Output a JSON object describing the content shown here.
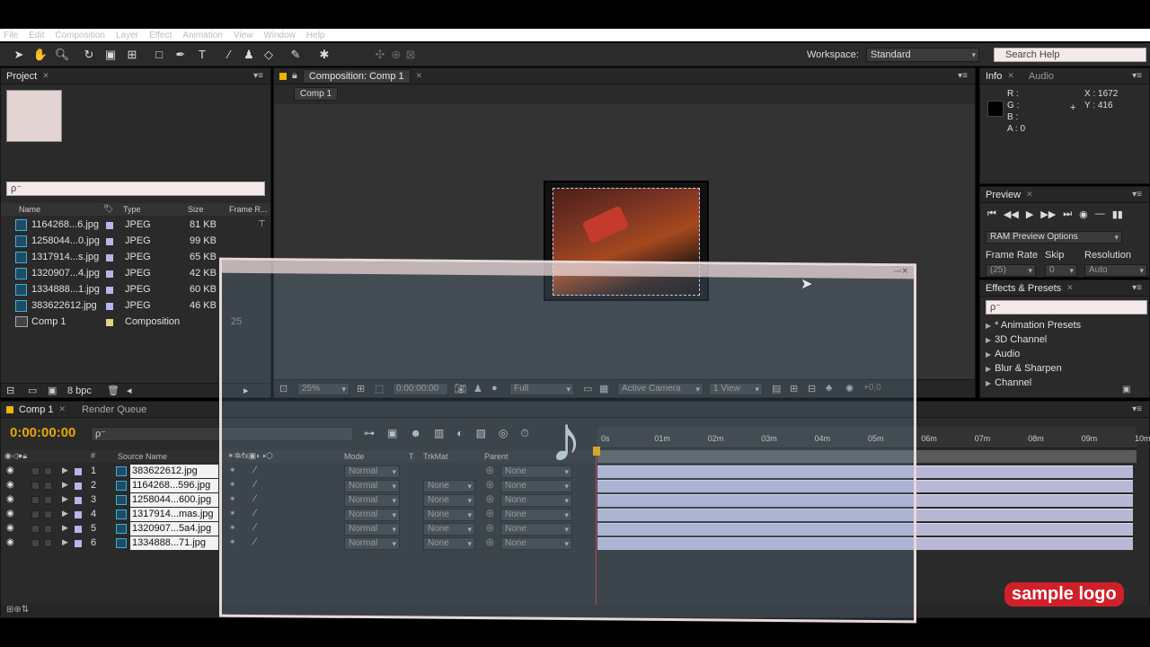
{
  "menu": [
    "File",
    "Edit",
    "Composition",
    "Layer",
    "Effect",
    "Animation",
    "View",
    "Window",
    "Help"
  ],
  "toolbar": {
    "workspace_label": "Workspace:",
    "workspace_value": "Standard",
    "search_help": "Search Help"
  },
  "project": {
    "tab": "Project",
    "search_placeholder": "ρ⁻",
    "columns": {
      "name": "Name",
      "type": "Type",
      "size": "Size",
      "frame_rate": "Frame R..."
    },
    "items": [
      {
        "name": "1164268...6.jpg",
        "type": "JPEG",
        "size": "81 KB",
        "frame": ""
      },
      {
        "name": "1258044...0.jpg",
        "type": "JPEG",
        "size": "99 KB",
        "frame": ""
      },
      {
        "name": "1317914...s.jpg",
        "type": "JPEG",
        "size": "65 KB",
        "frame": ""
      },
      {
        "name": "1320907...4.jpg",
        "type": "JPEG",
        "size": "42 KB",
        "frame": ""
      },
      {
        "name": "1334888...1.jpg",
        "type": "JPEG",
        "size": "60 KB",
        "frame": ""
      },
      {
        "name": "383622612.jpg",
        "type": "JPEG",
        "size": "46 KB",
        "frame": ""
      },
      {
        "name": "Comp 1",
        "type": "Composition",
        "size": "",
        "frame": "25"
      }
    ],
    "bpc": "8 bpc"
  },
  "composition": {
    "tab": "Composition: Comp 1",
    "breadcrumb": "Comp 1",
    "zoom": "25%",
    "timecode": "0:00:00:00",
    "resolution": "Full",
    "camera": "Active Camera",
    "views": "1 View",
    "exposure": "+0,0"
  },
  "info": {
    "tab": "Info",
    "tab2": "Audio",
    "r": "R :",
    "g": "G :",
    "b": "B :",
    "a": "A : 0",
    "x": "X : 1672",
    "y": "Y : 416"
  },
  "preview": {
    "tab": "Preview",
    "ram": "RAM Preview Options",
    "frame_rate_label": "Frame Rate",
    "skip_label": "Skip",
    "resolution_label": "Resolution",
    "frame_rate": "(25)",
    "skip": "0",
    "resolution": "Auto"
  },
  "effects": {
    "tab": "Effects & Presets",
    "search": "ρ⁻",
    "items": [
      "* Animation Presets",
      "3D Channel",
      "Audio",
      "Blur & Sharpen",
      "Channel"
    ]
  },
  "timeline": {
    "tab": "Comp 1",
    "tab2": "Render Queue",
    "timecode": "0:00:00:00",
    "search": "ρ⁻",
    "col_num": "#",
    "col_source": "Source Name",
    "col_mode": "Mode",
    "col_t": "T",
    "col_trk": "TrkMat",
    "col_parent": "Parent",
    "ruler": [
      "0s",
      "01m",
      "02m",
      "03m",
      "04m",
      "05m",
      "06m",
      "07m",
      "08m",
      "09m",
      "10m"
    ],
    "layers": [
      {
        "num": "1",
        "name": "383622612.jpg",
        "mode": "Normal",
        "trk": "",
        "parent": "None"
      },
      {
        "num": "2",
        "name": "1164268...596.jpg",
        "mode": "Normal",
        "trk": "None",
        "parent": "None"
      },
      {
        "num": "3",
        "name": "1258044...600.jpg",
        "mode": "Normal",
        "trk": "None",
        "parent": "None"
      },
      {
        "num": "4",
        "name": "1317914...mas.jpg",
        "mode": "Normal",
        "trk": "None",
        "parent": "None"
      },
      {
        "num": "5",
        "name": "1320907...5a4.jpg",
        "mode": "Normal",
        "trk": "None",
        "parent": "None"
      },
      {
        "num": "6",
        "name": "1334888...71.jpg",
        "mode": "Normal",
        "trk": "None",
        "parent": "None"
      }
    ]
  },
  "watermark": "sample logo",
  "colors": {
    "accent": "#e8a800",
    "track": "#b8b8d6",
    "timecode": "#e8a800",
    "logo_bg": "#d0202a"
  }
}
